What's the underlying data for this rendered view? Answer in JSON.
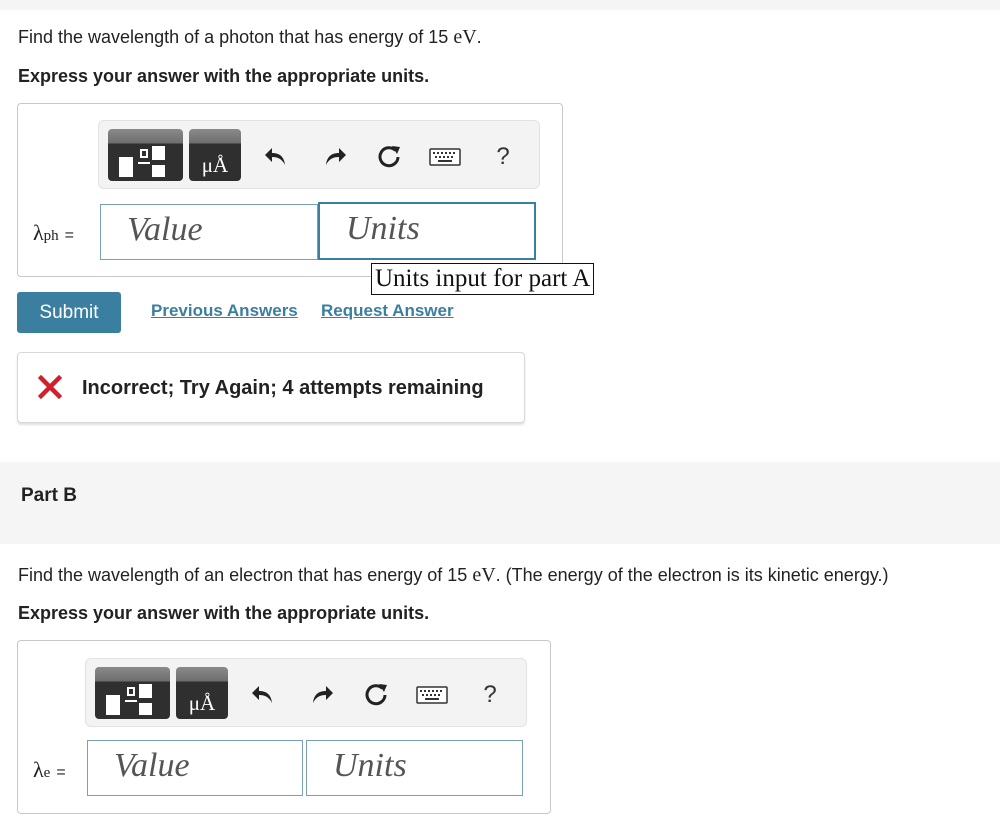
{
  "part_a": {
    "question_prefix": "Find the wavelength of a photon that has energy of 15 ",
    "energy_unit": "eV",
    "question_suffix": ".",
    "instruction": "Express your answer with the appropriate units.",
    "variable_symbol": "λ",
    "variable_subscript": "ph",
    "equals": "=",
    "value_placeholder": "Value",
    "units_placeholder": "Units",
    "units_tooltip": "Units input for part A",
    "submit_label": "Submit",
    "previous_answers_label": "Previous Answers",
    "request_answer_label": "Request Answer",
    "feedback_text": "Incorrect; Try Again; 4 attempts remaining",
    "feedback_color": "#d0202b"
  },
  "toolbar": {
    "units_button_label": "μÅ",
    "help_label": "?",
    "icons": [
      "templates-icon",
      "units-icon",
      "undo-icon",
      "redo-icon",
      "reset-icon",
      "keyboard-icon",
      "help-icon"
    ]
  },
  "part_b": {
    "title": "Part B",
    "question_prefix": "Find the wavelength of an electron that has energy of 15 ",
    "energy_unit": "eV",
    "question_suffix": ". (The energy of the electron is its kinetic energy.)",
    "instruction": "Express your answer with the appropriate units.",
    "variable_symbol": "λ",
    "variable_subscript": "e",
    "equals": "=",
    "value_placeholder": "Value",
    "units_placeholder": "Units"
  },
  "colors": {
    "accent": "#3a7fa0",
    "error": "#d0202b"
  }
}
